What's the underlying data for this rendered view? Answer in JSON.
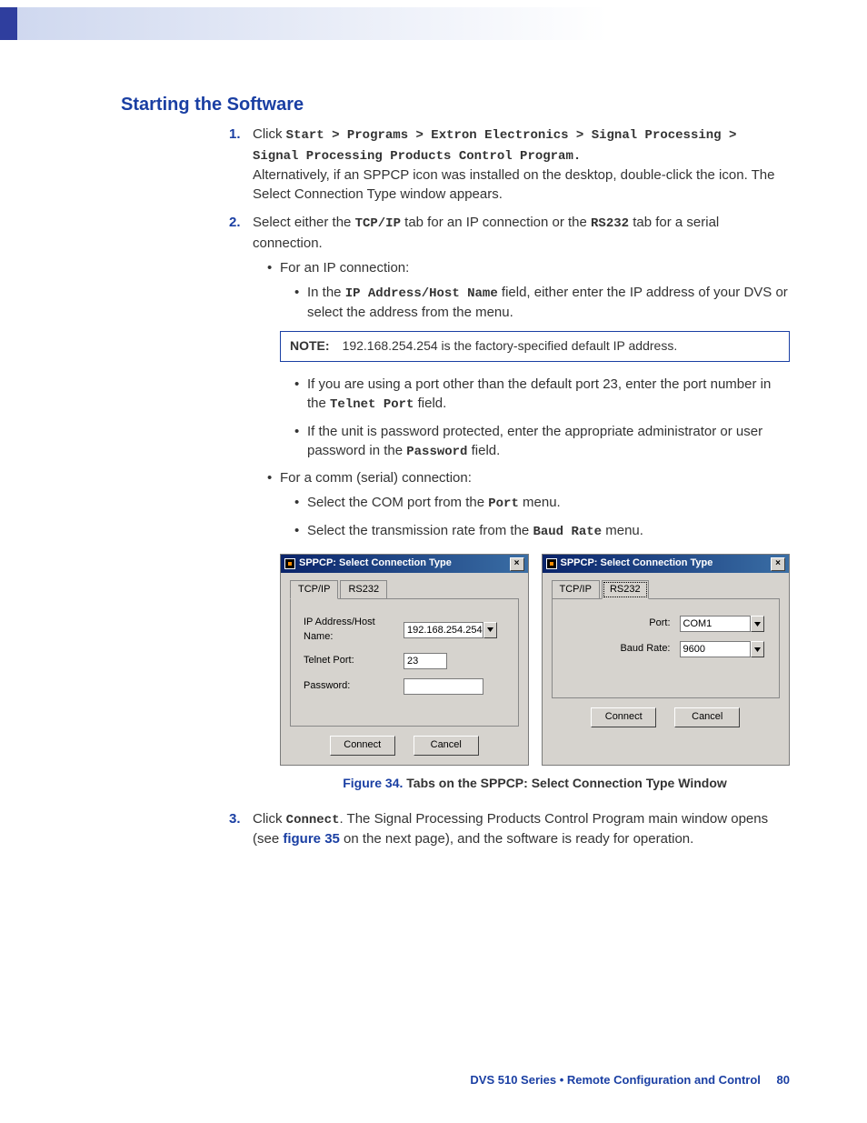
{
  "heading": "Starting the Software",
  "steps": {
    "s1_num": "1.",
    "s1_lead": "Click ",
    "s1_path": "Start > Programs > Extron Electronics > Signal Processing > Signal Processing Products Control Program.",
    "s1_alt": "Alternatively, if an SPPCP icon was installed on the desktop, double-click the icon. The Select Connection Type window appears.",
    "s2_num": "2.",
    "s2_a": "Select either the ",
    "s2_tcpip": "TCP/IP",
    "s2_b": " tab for an IP connection or the ",
    "s2_rs232": "RS232",
    "s2_c": " tab for a serial connection.",
    "ip_lead": "For an IP connection:",
    "ip_b1_a": "In the ",
    "ip_b1_field": "IP Address/Host Name",
    "ip_b1_b": " field, either enter the IP address of your DVS or select the address from the menu.",
    "note_label": "NOTE:",
    "note_text": "192.168.254.254 is the factory-specified default IP address.",
    "ip_b2_a": "If you are using a port other than the default port 23, enter the port number in the ",
    "ip_b2_field": "Telnet Port",
    "ip_b2_b": " field.",
    "ip_b3_a": "If the unit is password protected, enter the appropriate administrator or user password in the ",
    "ip_b3_field": "Password",
    "ip_b3_b": " field.",
    "comm_lead": "For a comm (serial) connection:",
    "comm_b1_a": "Select the COM port from the ",
    "comm_b1_field": "Port",
    "comm_b1_b": " menu.",
    "comm_b2_a": "Select the transmission rate from the ",
    "comm_b2_field": "Baud Rate",
    "comm_b2_b": " menu.",
    "s3_num": "3.",
    "s3_a": "Click ",
    "s3_connect": "Connect",
    "s3_b": ". The Signal Processing Products Control Program main window opens (see ",
    "s3_figref": "figure 35",
    "s3_c": " on the next page), and the software is ready for operation."
  },
  "dialog": {
    "title": "SPPCP:  Select Connection Type",
    "tab_tcpip": "TCP/IP",
    "tab_rs232": "RS232",
    "lbl_ip": "IP Address/Host Name:",
    "val_ip": "192.168.254.254",
    "lbl_telnet": "Telnet Port:",
    "val_telnet": "23",
    "lbl_pw": "Password:",
    "lbl_port": "Port:",
    "val_port": "COM1",
    "lbl_baud": "Baud Rate:",
    "val_baud": "9600",
    "btn_connect": "Connect",
    "btn_cancel": "Cancel"
  },
  "figure": {
    "num": "Figure 34. ",
    "text": "Tabs on the SPPCP: Select Connection Type Window"
  },
  "footer": {
    "title": "DVS 510 Series • Remote Configuration and Control",
    "page": "80"
  }
}
